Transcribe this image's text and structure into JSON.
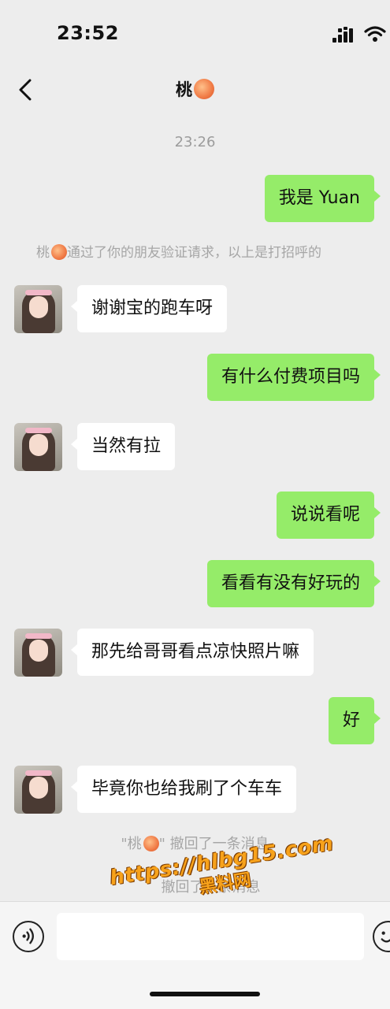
{
  "status_bar": {
    "time": "23:52"
  },
  "header": {
    "title": "桃"
  },
  "timestamp": "23:26",
  "system_message": {
    "contact": "桃",
    "text": "通过了你的朋友验证请求，以上是打招呼的"
  },
  "messages": [
    {
      "side": "right",
      "text": "我是 Yuan"
    },
    {
      "side": "left",
      "text": "谢谢宝的跑车呀"
    },
    {
      "side": "right",
      "text": "有什么付费项目吗"
    },
    {
      "side": "left",
      "text": "当然有拉"
    },
    {
      "side": "right",
      "text": "说说看呢"
    },
    {
      "side": "right",
      "text": "看看有没有好玩的"
    },
    {
      "side": "left",
      "text": "那先给哥哥看点凉快照片嘛"
    },
    {
      "side": "right",
      "text": "好"
    },
    {
      "side": "left",
      "text": "毕竟你也给我刷了个车车"
    }
  ],
  "recalls": [
    {
      "quote_open": "\"桃",
      "quote_close": "\"",
      "text": "撤回了一条消息"
    },
    {
      "text": "撤回了一条消息"
    }
  ],
  "watermark": {
    "url": "https://hlbg15.com",
    "sub": "黑料网"
  },
  "input": {
    "value": ""
  },
  "icons": {
    "peach": "peach-emoji",
    "voice": "voice-icon",
    "emoji": "emoji-icon",
    "back": "back-icon"
  },
  "colors": {
    "background": "#ededed",
    "bubble_right": "#95ec69",
    "bubble_left": "#ffffff",
    "watermark": "#f7a21b"
  }
}
